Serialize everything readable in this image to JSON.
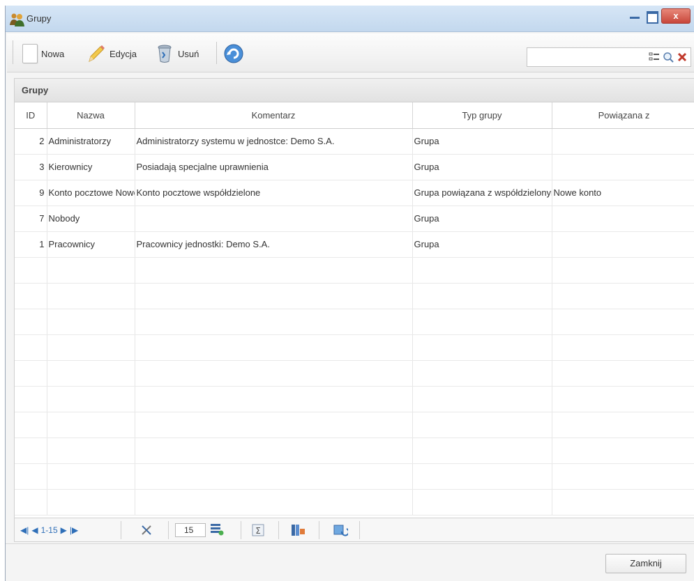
{
  "window": {
    "title": "Grupy",
    "close_symbol": "x"
  },
  "toolbar": {
    "new_label": "Nowa",
    "edit_label": "Edycja",
    "delete_label": "Usuń",
    "search": {
      "value": "",
      "placeholder": ""
    }
  },
  "panel": {
    "title": "Grupy"
  },
  "grid": {
    "columns": [
      "ID",
      "Nazwa",
      "Komentarz",
      "Typ grupy",
      "Powiązana z"
    ],
    "rows": [
      [
        "2",
        "Administratorzy",
        "Administratorzy systemu w jednostce: Demo S.A.",
        "Grupa",
        ""
      ],
      [
        "3",
        "Kierownicy",
        "Posiadają specjalne uprawnienia",
        "Grupa",
        ""
      ],
      [
        "9",
        "Konto pocztowe Nowe konto",
        "Konto pocztowe współdzielone",
        "Grupa powiązana z współdzielonym kontem pocztowym",
        "Nowe konto"
      ],
      [
        "7",
        "Nobody",
        "",
        "Grupa",
        ""
      ],
      [
        "1",
        "Pracownicy",
        "Pracownicy jednostki: Demo S.A.",
        "Grupa",
        ""
      ]
    ],
    "empty_rows": 10
  },
  "pager": {
    "range_label": "1-15",
    "page_size": "15"
  },
  "footer": {
    "close_label": "Zamknij"
  },
  "colors": {
    "accent": "#2f6fb8",
    "titlebar": "#c3d8ee",
    "close_button": "#c8463a"
  },
  "icons": {
    "title": "users-group-icon",
    "new": "new-document-icon",
    "edit": "pencil-icon",
    "delete": "trash-icon",
    "refresh": "refresh-icon",
    "search_options": "checklist-icon",
    "search": "magnifier-icon",
    "clear": "clear-x-icon"
  }
}
